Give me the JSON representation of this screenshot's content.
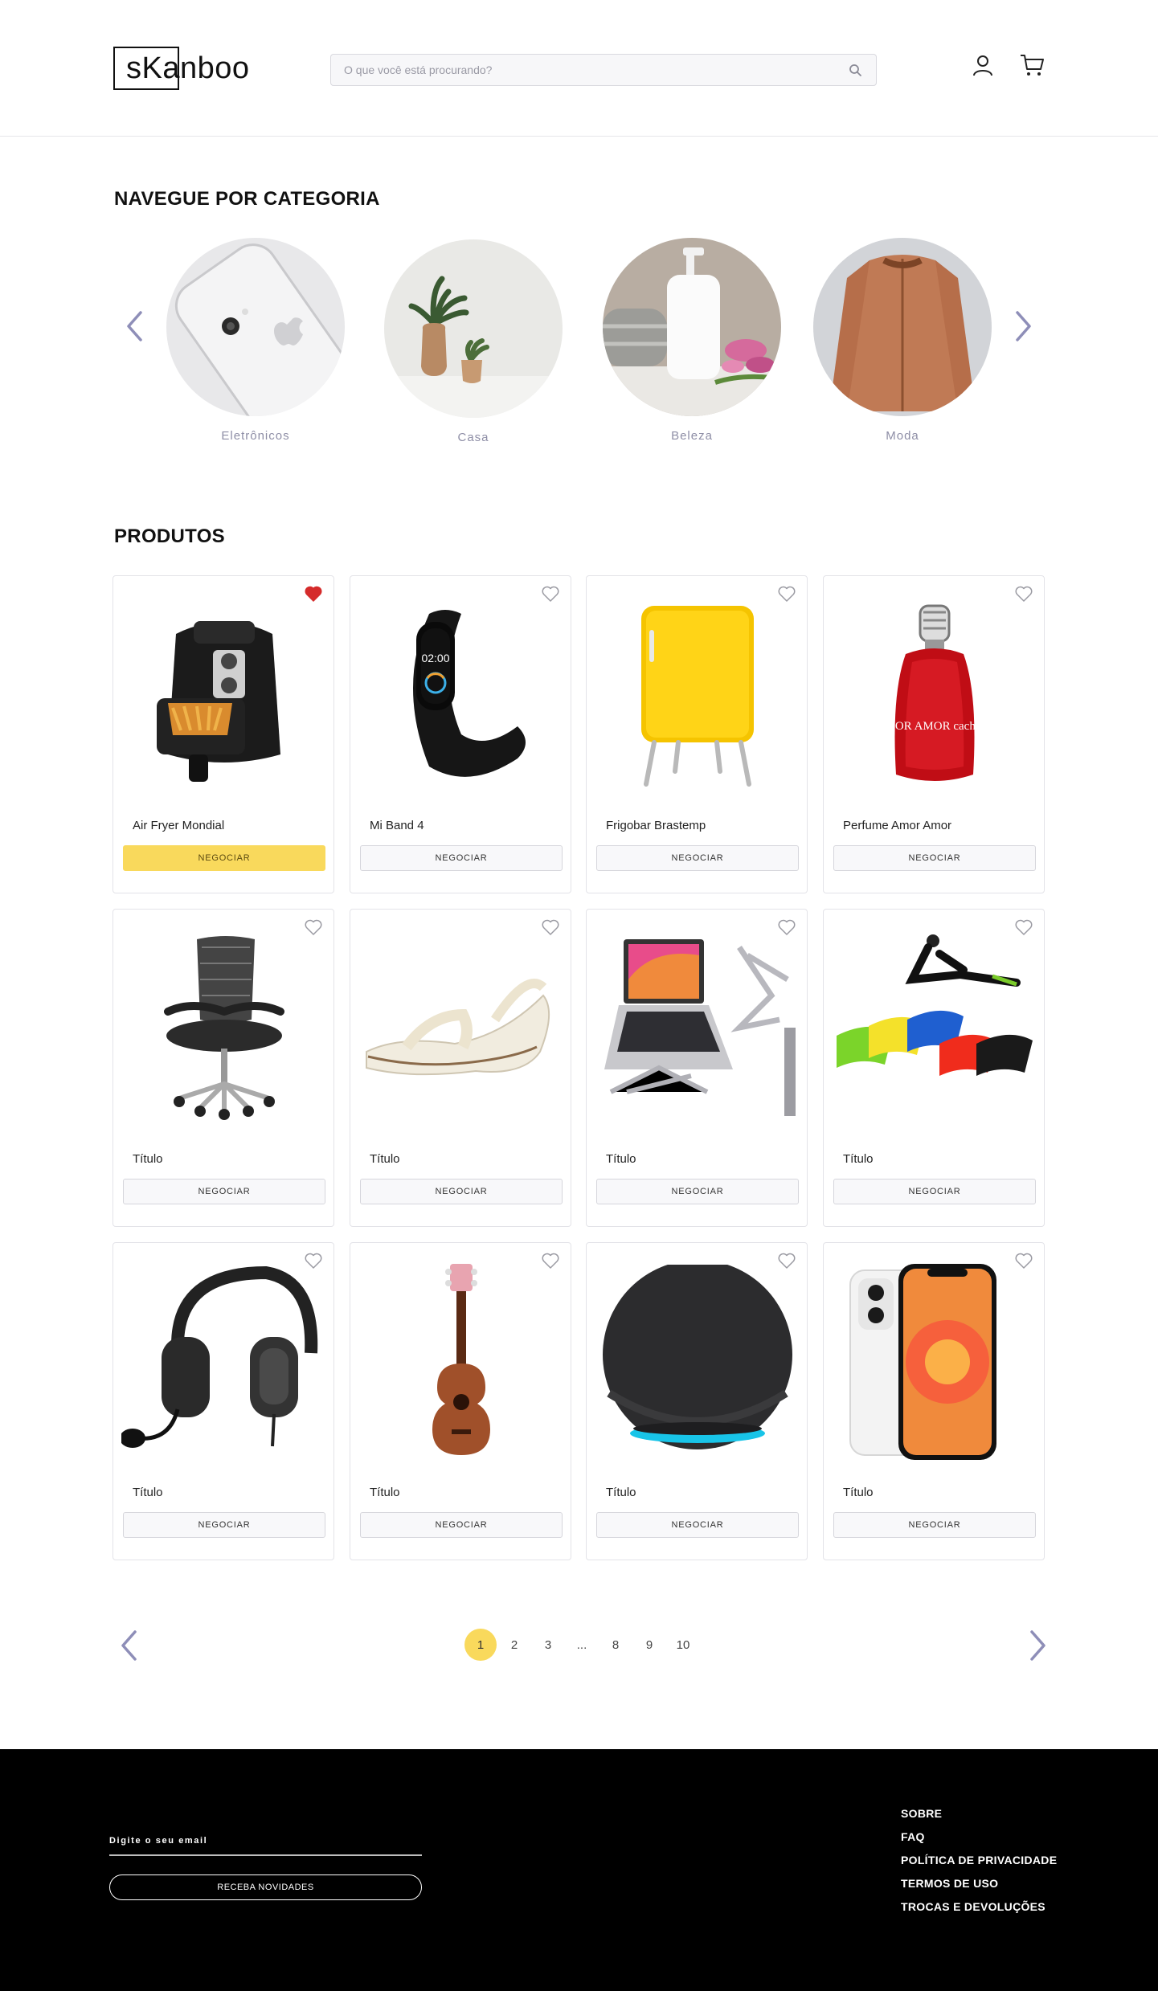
{
  "header": {
    "logo_text": "sKanboo",
    "search_placeholder": "O que você está procurando?"
  },
  "categories_section": {
    "title": "NAVEGUE POR CATEGORIA",
    "items": [
      {
        "label": "Eletrônicos"
      },
      {
        "label": "Casa"
      },
      {
        "label": "Beleza"
      },
      {
        "label": "Moda"
      }
    ]
  },
  "products_section": {
    "title": "PRODUTOS",
    "items": [
      {
        "title": "Air Fryer Mondial",
        "button": "NEGOCIAR",
        "favorited": true,
        "image": "air-fryer"
      },
      {
        "title": "Mi Band 4",
        "button": "NEGOCIAR",
        "favorited": false,
        "image": "smart-band"
      },
      {
        "title": "Frigobar Brastemp",
        "button": "NEGOCIAR",
        "favorited": false,
        "image": "mini-fridge"
      },
      {
        "title": "Perfume Amor Amor",
        "button": "NEGOCIAR",
        "favorited": false,
        "image": "perfume",
        "image_text": "AMOR AMOR cacharel"
      },
      {
        "title": "Título",
        "button": "NEGOCIAR",
        "favorited": false,
        "image": "office-chair"
      },
      {
        "title": "Título",
        "button": "NEGOCIAR",
        "favorited": false,
        "image": "sandal"
      },
      {
        "title": "Título",
        "button": "NEGOCIAR",
        "favorited": false,
        "image": "laptop-stand"
      },
      {
        "title": "Título",
        "button": "NEGOCIAR",
        "favorited": false,
        "image": "resistance-bands"
      },
      {
        "title": "Título",
        "button": "NEGOCIAR",
        "favorited": false,
        "image": "headset"
      },
      {
        "title": "Título",
        "button": "NEGOCIAR",
        "favorited": false,
        "image": "ukulele"
      },
      {
        "title": "Título",
        "button": "NEGOCIAR",
        "favorited": false,
        "image": "smart-speaker"
      },
      {
        "title": "Título",
        "button": "NEGOCIAR",
        "favorited": false,
        "image": "iphone"
      }
    ]
  },
  "pagination": {
    "pages": [
      "1",
      "2",
      "3",
      "...",
      "8",
      "9",
      "10"
    ],
    "current": "1"
  },
  "footer": {
    "email_label": "Digite o seu email",
    "newsletter_button": "RECEBA NOVIDADES",
    "links": [
      "SOBRE",
      "FAQ",
      "POLÍTICA DE PRIVACIDADE",
      "TERMOS DE USO",
      "TROCAS E DEVOLUÇÕES"
    ]
  },
  "colors": {
    "accent_yellow": "#f9d95c",
    "favorite_red": "#d52b2b",
    "arrow_purple": "#8e8eb8",
    "footer_bg": "#000000"
  }
}
